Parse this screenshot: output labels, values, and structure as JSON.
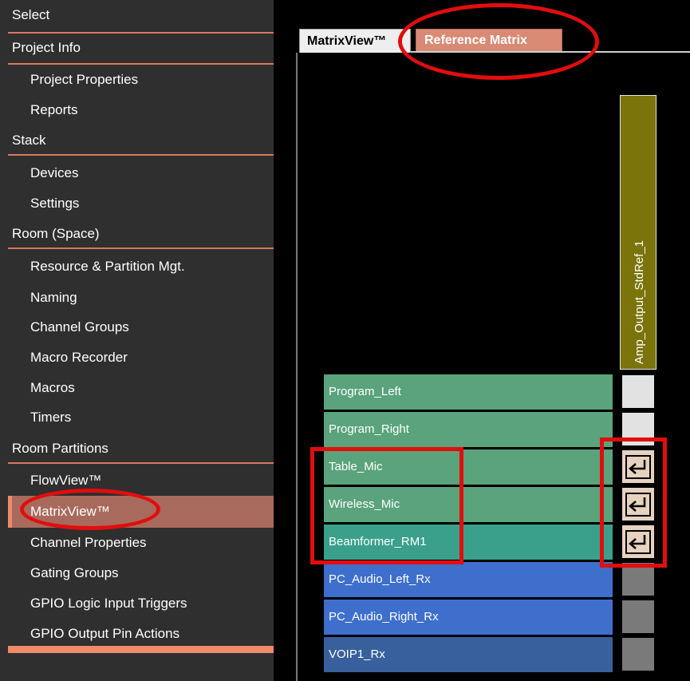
{
  "sidebar": {
    "items": [
      {
        "label": "Select",
        "kind": "section"
      },
      {
        "label": "Project Info",
        "kind": "section"
      },
      {
        "label": "Project Properties",
        "kind": "sub"
      },
      {
        "label": "Reports",
        "kind": "sub"
      },
      {
        "label": "Stack",
        "kind": "section"
      },
      {
        "label": "Devices",
        "kind": "sub"
      },
      {
        "label": "Settings",
        "kind": "sub"
      },
      {
        "label": "Room (Space)",
        "kind": "section"
      },
      {
        "label": "Resource & Partition Mgt.",
        "kind": "sub"
      },
      {
        "label": "Naming",
        "kind": "sub"
      },
      {
        "label": "Channel Groups",
        "kind": "sub"
      },
      {
        "label": "Macro Recorder",
        "kind": "sub"
      },
      {
        "label": "Macros",
        "kind": "sub"
      },
      {
        "label": "Timers",
        "kind": "sub"
      },
      {
        "label": "Room Partitions",
        "kind": "section"
      },
      {
        "label": "FlowView™",
        "kind": "sub"
      },
      {
        "label": "MatrixView™",
        "kind": "sub",
        "selected": true
      },
      {
        "label": "Channel Properties",
        "kind": "sub"
      },
      {
        "label": "Gating Groups",
        "kind": "sub"
      },
      {
        "label": "GPIO Logic Input Triggers",
        "kind": "sub"
      },
      {
        "label": "GPIO Output Pin Actions",
        "kind": "sub"
      }
    ]
  },
  "tabs": [
    {
      "label": "MatrixView™",
      "active": true
    },
    {
      "label": "Reference Matrix",
      "active": false,
      "highlighted": true
    }
  ],
  "matrix": {
    "column_header": "Amp_Output_StdRef_1",
    "column_color": "#7a740a",
    "rows": [
      {
        "label": "Program_Left",
        "color": "#5aa37c",
        "cell": "empty-light"
      },
      {
        "label": "Program_Right",
        "color": "#5aa37c",
        "cell": "empty-light"
      },
      {
        "label": "Table_Mic",
        "color": "#5aa37c",
        "cell": "reference-arrow-icon"
      },
      {
        "label": "Wireless_Mic",
        "color": "#5aa37c",
        "cell": "reference-arrow-icon"
      },
      {
        "label": "Beamformer_RM1",
        "color": "#3aa08b",
        "cell": "reference-arrow-icon"
      },
      {
        "label": "PC_Audio_Left_Rx",
        "color": "#3e6fcc",
        "cell": "empty-gray"
      },
      {
        "label": "PC_Audio_Right_Rx",
        "color": "#3e6fcc",
        "cell": "empty-gray"
      },
      {
        "label": "VOIP1_Rx",
        "color": "#37609c",
        "cell": "empty-gray"
      }
    ]
  },
  "colors": {
    "sidebar_bg": "#2f2f2f",
    "accent": "#f08a68",
    "selected_item": "#a86a5c",
    "callout_red": "#e20d0d"
  }
}
